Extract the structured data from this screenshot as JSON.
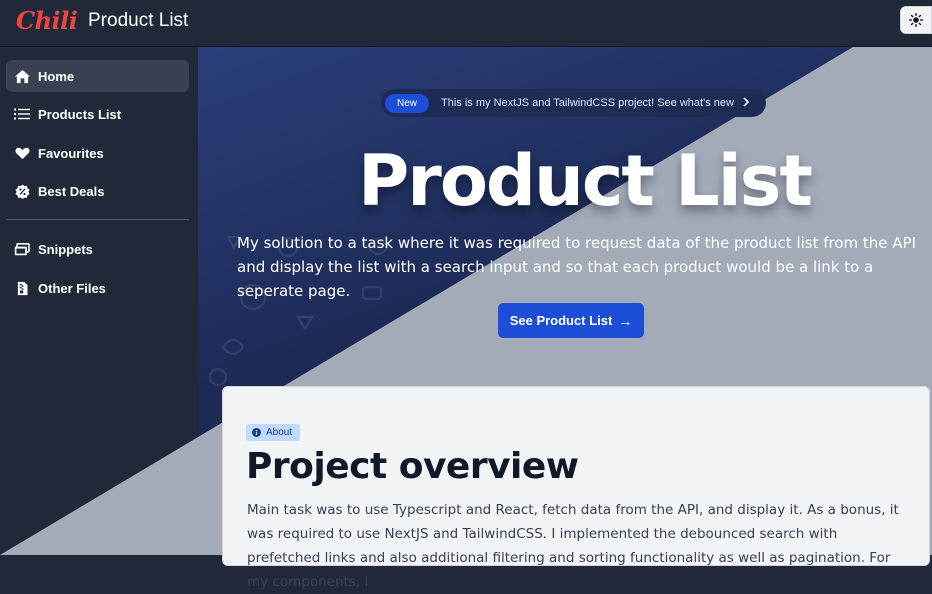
{
  "header": {
    "logo": "Chili",
    "title": "Product List",
    "theme_toggle_icon": "sun-icon"
  },
  "sidebar": {
    "items": [
      {
        "label": "Home",
        "icon": "home-icon",
        "active": true
      },
      {
        "label": "Products List",
        "icon": "list-icon"
      },
      {
        "label": "Favourites",
        "icon": "heart-icon"
      },
      {
        "label": "Best Deals",
        "icon": "discount-icon"
      },
      {
        "label": "Snippets",
        "icon": "snippets-icon"
      },
      {
        "label": "Other Files",
        "icon": "files-icon"
      }
    ]
  },
  "hero": {
    "badge": "New",
    "announcement": "This is my NextJS and TailwindCSS project! See what's new",
    "title": "Product List",
    "description": "My solution to a task where it was required to request data of the product list from the API and display the list with a search input and so that each product would be a link to a seperate page.",
    "cta_label": "See Product List",
    "cta_arrow": "→"
  },
  "overview": {
    "badge": "About",
    "title": "Project overview",
    "text": "Main task was to use Typescript and React, fetch data from the API, and display it. As a bonus, it was required to use NextJS and TailwindCSS. I implemented the debounced search with prefetched links and also additional filtering and sorting functionality as well as pagination. For my components, I"
  },
  "colors": {
    "accent": "#1d4ed8",
    "brand": "#ef4444",
    "sidebar_bg": "#1f2937"
  }
}
